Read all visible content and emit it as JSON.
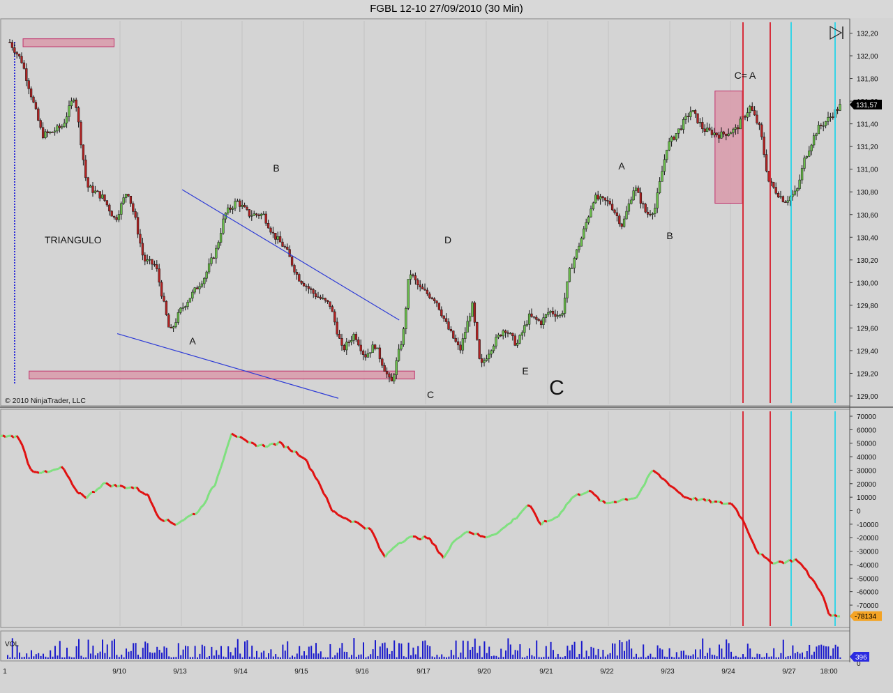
{
  "window": {
    "title": "FGBL 12-10  27/09/2010 (30 Min)"
  },
  "copyright": "© 2010 NinjaTrader, LLC",
  "chart_data": {
    "type": "candlestick",
    "title": "FGBL 12-10  27/09/2010 (30 Min)",
    "price_axis": {
      "ticks": [
        "132,20",
        "132,00",
        "131,80",
        "131,60",
        "131,40",
        "131,20",
        "131,00",
        "130,80",
        "130,60",
        "130,40",
        "130,20",
        "130,00",
        "129,80",
        "129,60",
        "129,40",
        "129,20",
        "129,00"
      ],
      "ylim": [
        128.98,
        132.24
      ],
      "last_price": "131,57",
      "last_price_value": 131.57
    },
    "x_axis": {
      "ticks": [
        "1",
        "9/10",
        "9/13",
        "9/14",
        "9/15",
        "9/16",
        "9/17",
        "9/20",
        "9/21",
        "9/22",
        "9/23",
        "9/24",
        "9/27",
        "18:00"
      ]
    },
    "price_path": [
      {
        "x": 0.0,
        "p": 132.12
      },
      {
        "x": 0.3,
        "p": 131.95
      },
      {
        "x": 0.8,
        "p": 131.3
      },
      {
        "x": 1.0,
        "p": 131.32
      },
      {
        "x": 1.3,
        "p": 131.38
      },
      {
        "x": 1.6,
        "p": 131.66
      },
      {
        "x": 1.9,
        "p": 130.85
      },
      {
        "x": 2.3,
        "p": 130.75
      },
      {
        "x": 2.6,
        "p": 130.55
      },
      {
        "x": 2.9,
        "p": 130.82
      },
      {
        "x": 3.1,
        "p": 130.55
      },
      {
        "x": 3.3,
        "p": 130.2
      },
      {
        "x": 3.6,
        "p": 130.15
      },
      {
        "x": 3.95,
        "p": 129.55
      },
      {
        "x": 4.2,
        "p": 129.75
      },
      {
        "x": 4.5,
        "p": 129.9
      },
      {
        "x": 4.8,
        "p": 130.05
      },
      {
        "x": 5.1,
        "p": 130.3
      },
      {
        "x": 5.3,
        "p": 130.6
      },
      {
        "x": 5.6,
        "p": 130.72
      },
      {
        "x": 5.9,
        "p": 130.6
      },
      {
        "x": 6.25,
        "p": 130.6
      },
      {
        "x": 6.5,
        "p": 130.42
      },
      {
        "x": 6.8,
        "p": 130.3
      },
      {
        "x": 7.1,
        "p": 130.05
      },
      {
        "x": 7.5,
        "p": 129.9
      },
      {
        "x": 7.9,
        "p": 129.8
      },
      {
        "x": 8.2,
        "p": 129.4
      },
      {
        "x": 8.5,
        "p": 129.55
      },
      {
        "x": 8.75,
        "p": 129.35
      },
      {
        "x": 9.0,
        "p": 129.45
      },
      {
        "x": 9.4,
        "p": 129.1
      },
      {
        "x": 9.7,
        "p": 129.55
      },
      {
        "x": 9.85,
        "p": 130.1
      },
      {
        "x": 10.1,
        "p": 129.95
      },
      {
        "x": 10.5,
        "p": 129.85
      },
      {
        "x": 10.8,
        "p": 129.6
      },
      {
        "x": 11.1,
        "p": 129.4
      },
      {
        "x": 11.4,
        "p": 129.8
      },
      {
        "x": 11.6,
        "p": 129.25
      },
      {
        "x": 11.9,
        "p": 129.45
      },
      {
        "x": 12.2,
        "p": 129.6
      },
      {
        "x": 12.5,
        "p": 129.45
      },
      {
        "x": 12.8,
        "p": 129.7
      },
      {
        "x": 13.1,
        "p": 129.65
      },
      {
        "x": 13.3,
        "p": 129.75
      },
      {
        "x": 13.6,
        "p": 129.7
      },
      {
        "x": 13.8,
        "p": 130.1
      },
      {
        "x": 14.1,
        "p": 130.4
      },
      {
        "x": 14.4,
        "p": 130.75
      },
      {
        "x": 14.8,
        "p": 130.7
      },
      {
        "x": 15.1,
        "p": 130.5
      },
      {
        "x": 15.4,
        "p": 130.85
      },
      {
        "x": 15.7,
        "p": 130.6
      },
      {
        "x": 15.9,
        "p": 130.65
      },
      {
        "x": 16.2,
        "p": 131.2
      },
      {
        "x": 16.5,
        "p": 131.35
      },
      {
        "x": 16.8,
        "p": 131.52
      },
      {
        "x": 17.1,
        "p": 131.35
      },
      {
        "x": 17.5,
        "p": 131.3
      },
      {
        "x": 17.9,
        "p": 131.35
      },
      {
        "x": 18.25,
        "p": 131.55
      },
      {
        "x": 18.5,
        "p": 131.35
      },
      {
        "x": 18.7,
        "p": 130.9
      },
      {
        "x": 18.9,
        "p": 130.8
      },
      {
        "x": 19.1,
        "p": 130.72
      },
      {
        "x": 19.4,
        "p": 130.8
      },
      {
        "x": 19.6,
        "p": 131.1
      },
      {
        "x": 19.9,
        "p": 131.35
      },
      {
        "x": 20.2,
        "p": 131.45
      },
      {
        "x": 20.5,
        "p": 131.57
      }
    ],
    "series": [
      {
        "name": "VOL"
      }
    ],
    "indicator": {
      "ticks": [
        "70000",
        "60000",
        "50000",
        "40000",
        "30000",
        "20000",
        "10000",
        "0",
        "-10000",
        "-20000",
        "-30000",
        "-40000",
        "-50000",
        "-60000",
        "-70000"
      ],
      "ylim": [
        -84000,
        72000
      ],
      "last_value": "-78134",
      "path": [
        {
          "x": 0.0,
          "v": 55000
        },
        {
          "x": 0.4,
          "v": 55000
        },
        {
          "x": 0.7,
          "v": 30000
        },
        {
          "x": 1.1,
          "v": 28000
        },
        {
          "x": 1.5,
          "v": 32000
        },
        {
          "x": 1.8,
          "v": 15000
        },
        {
          "x": 2.1,
          "v": 10000
        },
        {
          "x": 2.5,
          "v": 20000
        },
        {
          "x": 2.9,
          "v": 18000
        },
        {
          "x": 3.3,
          "v": 17000
        },
        {
          "x": 3.6,
          "v": 12000
        },
        {
          "x": 3.9,
          "v": -5000
        },
        {
          "x": 4.3,
          "v": -10000
        },
        {
          "x": 4.6,
          "v": -5000
        },
        {
          "x": 4.9,
          "v": 0
        },
        {
          "x": 5.3,
          "v": 20000
        },
        {
          "x": 5.7,
          "v": 58000
        },
        {
          "x": 6.1,
          "v": 50000
        },
        {
          "x": 6.5,
          "v": 48000
        },
        {
          "x": 6.9,
          "v": 50000
        },
        {
          "x": 7.2,
          "v": 45000
        },
        {
          "x": 7.5,
          "v": 40000
        },
        {
          "x": 7.9,
          "v": 20000
        },
        {
          "x": 8.2,
          "v": 0
        },
        {
          "x": 8.5,
          "v": -5000
        },
        {
          "x": 8.9,
          "v": -10000
        },
        {
          "x": 9.2,
          "v": -15000
        },
        {
          "x": 9.5,
          "v": -35000
        },
        {
          "x": 9.8,
          "v": -25000
        },
        {
          "x": 10.1,
          "v": -20000
        },
        {
          "x": 10.6,
          "v": -20000
        },
        {
          "x": 11.0,
          "v": -35000
        },
        {
          "x": 11.3,
          "v": -20000
        },
        {
          "x": 11.6,
          "v": -15000
        },
        {
          "x": 12.0,
          "v": -20000
        },
        {
          "x": 12.4,
          "v": -15000
        },
        {
          "x": 12.8,
          "v": -5000
        },
        {
          "x": 13.1,
          "v": 5000
        },
        {
          "x": 13.4,
          "v": -10000
        },
        {
          "x": 13.8,
          "v": -5000
        },
        {
          "x": 14.2,
          "v": 10000
        },
        {
          "x": 14.6,
          "v": 15000
        },
        {
          "x": 15.0,
          "v": 5000
        },
        {
          "x": 15.4,
          "v": 8000
        },
        {
          "x": 15.8,
          "v": 10000
        },
        {
          "x": 16.2,
          "v": 30000
        },
        {
          "x": 16.6,
          "v": 20000
        },
        {
          "x": 17.0,
          "v": 10000
        },
        {
          "x": 17.4,
          "v": 8000
        },
        {
          "x": 17.8,
          "v": 6000
        },
        {
          "x": 18.2,
          "v": 5000
        },
        {
          "x": 18.5,
          "v": -10000
        },
        {
          "x": 18.8,
          "v": -30000
        },
        {
          "x": 19.1,
          "v": -38000
        },
        {
          "x": 19.5,
          "v": -38000
        },
        {
          "x": 19.8,
          "v": -36000
        },
        {
          "x": 20.1,
          "v": -48000
        },
        {
          "x": 20.4,
          "v": -60000
        },
        {
          "x": 20.6,
          "v": -78000
        },
        {
          "x": 20.9,
          "v": -78134
        }
      ]
    },
    "volume": {
      "label": "VOL",
      "last_value": "396"
    },
    "annotations": [
      {
        "text": "TRIANGULO"
      },
      {
        "text": "A",
        "x": 5.3,
        "p": 129.55
      },
      {
        "text": "B",
        "x": 8.5,
        "p": 131.0
      },
      {
        "text": "C",
        "x": 13.4,
        "p": 129.08
      },
      {
        "text": "D",
        "x": 13.8,
        "p": 130.38
      },
      {
        "text": "E",
        "x": 16.0,
        "p": 129.26
      },
      {
        "text": "C",
        "x": 17.2,
        "p": 129.1
      },
      {
        "text": "A",
        "x": 19.2,
        "p": 131.0
      },
      {
        "text": "B",
        "x": 20.7,
        "p": 130.45
      },
      {
        "text": "C= A",
        "x": 22.6,
        "p": 131.8
      }
    ],
    "trendlines": [
      {
        "from": {
          "x": 8.5,
          "p": 130.82
        },
        "to": {
          "x": 19.2,
          "p": 129.67
        }
      },
      {
        "from": {
          "x": 5.3,
          "p": 129.55
        },
        "to": {
          "x": 16.2,
          "p": 128.98
        }
      }
    ],
    "zones": [
      {
        "from_x": 0.3,
        "to_x": 3.3,
        "low": 132.08,
        "high": 132.15
      },
      {
        "from_x": 0.5,
        "to_x": 13.2,
        "low": 129.15,
        "high": 129.22
      },
      {
        "from_x": 23.1,
        "to_x": 24.0,
        "low": 130.7,
        "high": 131.69
      }
    ],
    "vertical_lines": [
      {
        "x": 23.1,
        "color": "red"
      },
      {
        "x": 24.0,
        "color": "red"
      },
      {
        "x": 24.6,
        "color": "cyan"
      },
      {
        "x": 26.1,
        "color": "cyan"
      }
    ],
    "colors": {
      "up": "#6abf4b",
      "down": "#b22222",
      "background": "#d4d4d4",
      "trendline": "#2c3ad6",
      "volume": "#1a1acc",
      "zone": "#d99aaa",
      "vline_red": "#d62d3a",
      "vline_cyan": "#36d4e6"
    }
  }
}
